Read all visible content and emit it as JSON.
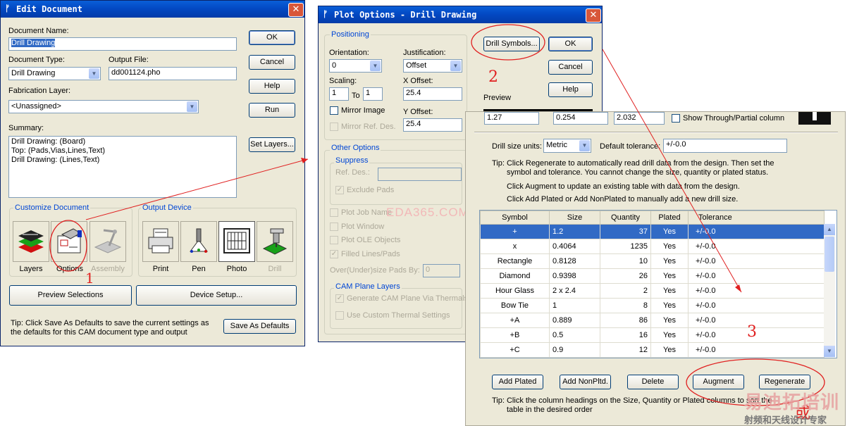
{
  "edit_doc": {
    "title": "Edit Document",
    "doc_name_label": "Document Name:",
    "doc_name_value": "Drill Drawing",
    "doc_type_label": "Document Type:",
    "doc_type_value": "Drill Drawing",
    "output_file_label": "Output File:",
    "output_file_value": "dd001124.pho",
    "fab_layer_label": "Fabrication Layer:",
    "fab_layer_value": "<Unassigned>",
    "summary_label": "Summary:",
    "summary_lines": [
      "Drill Drawing: (Board)",
      "Top: (Pads,Vias,Lines,Text)",
      "Drill Drawing: (Lines,Text)"
    ],
    "buttons": {
      "ok": "OK",
      "cancel": "Cancel",
      "help": "Help",
      "run": "Run",
      "set_layers": "Set Layers..."
    },
    "customize_title": "Customize Document",
    "output_device_title": "Output Device",
    "tiles": {
      "layers": "Layers",
      "options": "Options",
      "assembly": "Assembly",
      "print": "Print",
      "pen": "Pen",
      "photo": "Photo",
      "drill": "Drill"
    },
    "preview_btn": "Preview Selections",
    "device_setup_btn": "Device Setup...",
    "tip": "Tip: Click Save As Defaults to save the current settings as\nthe defaults for this CAM document type and output",
    "save_defaults_btn": "Save As Defaults"
  },
  "plot_options": {
    "title": "Plot Options - Drill Drawing",
    "positioning_title": "Positioning",
    "orientation_label": "Orientation:",
    "orientation_value": "0",
    "justification_label": "Justification:",
    "justification_value": "Offset",
    "scaling_label": "Scaling:",
    "scaling_a": "1",
    "scaling_to": "To",
    "scaling_b": "1",
    "x_offset_label": "X Offset:",
    "x_offset_value": "25.4",
    "y_offset_label": "Y Offset:",
    "y_offset_value": "25.4",
    "mirror_image": "Mirror Image",
    "mirror_ref": "Mirror Ref. Des.",
    "drill_symbols_btn": "Drill Symbols...",
    "ok_btn": "OK",
    "cancel_btn": "Cancel",
    "help_btn": "Help",
    "preview_label": "Preview",
    "other_options_title": "Other Options",
    "suppress_title": "Suppress",
    "ref_des_label": "Ref. Des.:",
    "exclude_pads": "Exclude Pads",
    "plot_job_name": "Plot Job Name",
    "plot_window": "Plot Window",
    "plot_ole": "Plot OLE Objects",
    "filled_lines": "Filled Lines/Pads",
    "oversize_label": "Over(Under)size Pads By:",
    "oversize_value": "0",
    "cam_plane_title": "CAM Plane Layers",
    "generate_thermals": "Generate CAM Plane Via Thermals",
    "custom_thermal": "Use Custom Thermal Settings",
    "watermark": "EDA365.COM"
  },
  "drill_symbols": {
    "top_fields": [
      "1.27",
      "0.254",
      "2.032"
    ],
    "show_through": "Show Through/Partial column",
    "units_label": "Drill size units:",
    "units_value": "Metric",
    "tolerance_label": "Default tolerance:",
    "tolerance_value": "+/-0.0",
    "tip1": "Tip: Click Regenerate to automatically read drill data from the design. Then set the",
    "tip1b": "symbol and tolerance. You cannot change the size, quantity or plated status.",
    "tip2": "Click Augment to update an existing table with data from the design.",
    "tip3": "Click Add Plated or Add NonPlated to manually add a new drill size.",
    "columns": [
      "Symbol",
      "Size",
      "Quantity",
      "Plated",
      "Tolerance"
    ],
    "rows": [
      [
        "+",
        "1.2",
        "37",
        "Yes",
        "+/-0.0"
      ],
      [
        "x",
        "0.4064",
        "1235",
        "Yes",
        "+/-0.0"
      ],
      [
        "Rectangle",
        "0.8128",
        "10",
        "Yes",
        "+/-0.0"
      ],
      [
        "Diamond",
        "0.9398",
        "26",
        "Yes",
        "+/-0.0"
      ],
      [
        "Hour Glass",
        "2 x 2.4",
        "2",
        "Yes",
        "+/-0.0"
      ],
      [
        "Bow Tie",
        "1",
        "8",
        "Yes",
        "+/-0.0"
      ],
      [
        "+A",
        "0.889",
        "86",
        "Yes",
        "+/-0.0"
      ],
      [
        "+B",
        "0.5",
        "16",
        "Yes",
        "+/-0.0"
      ],
      [
        "+C",
        "0.9",
        "12",
        "Yes",
        "+/-0.0"
      ]
    ],
    "buttons": {
      "add_plated": "Add Plated",
      "add_nonplated": "Add NonPltd.",
      "delete": "Delete",
      "augment": "Augment",
      "regenerate": "Regenerate"
    },
    "tip4": "Tip: Click the column headings on the Size, Quantity or Plated columns to sort the",
    "tip4b": "table in the desired order"
  },
  "annotations": {
    "n1": "1",
    "n2": "2",
    "n3": "3",
    "or": "或"
  },
  "branding": {
    "logo_text": "易迪拓培训",
    "slogan": "射频和天线设计专家"
  },
  "colors": {
    "accent_red": "#e02020",
    "title_blue": "#0349c4",
    "group_blue": "#0046d5",
    "selection": "#316ac5"
  }
}
